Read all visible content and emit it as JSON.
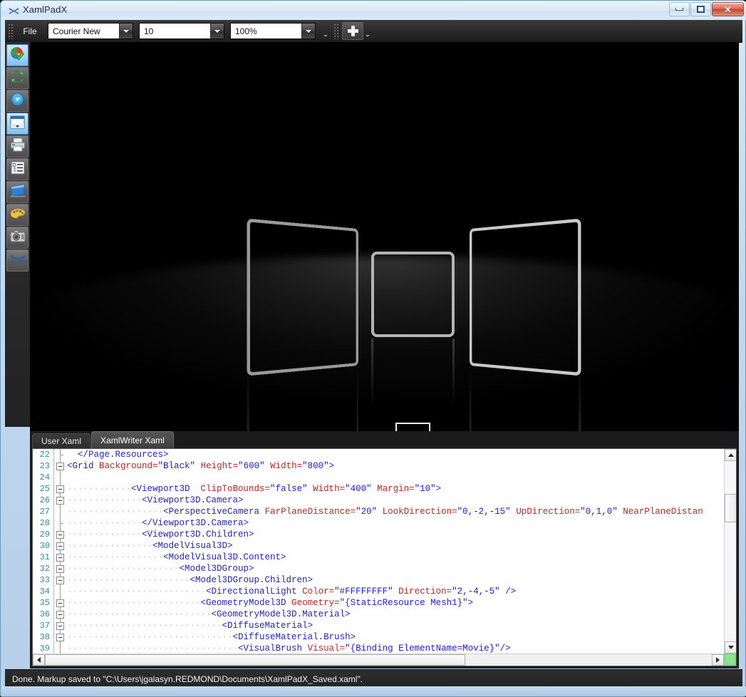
{
  "window": {
    "title": "XamlPadX",
    "app_icon": "xamlpadx-logo-icon",
    "caption": {
      "minimize": "minimize-icon",
      "maximize": "maximize-icon",
      "close": "✕"
    }
  },
  "toolbar": {
    "file_label_pre": "F",
    "file_label_accel": "F",
    "file_label_rest": "ile",
    "file_label": "File",
    "font_family": "Courier New",
    "font_size": "10",
    "zoom": "100%",
    "add_button": "+",
    "overflow": "chevron-down-icon"
  },
  "rail": {
    "items": [
      {
        "name": "refresh-render-icon",
        "selected": true
      },
      {
        "name": "auto-refresh-icon",
        "selected": false
      },
      {
        "name": "download-icon",
        "selected": false
      },
      {
        "name": "window-preview-icon",
        "selected": true
      },
      {
        "name": "print-icon",
        "selected": false
      },
      {
        "name": "tree-view-icon",
        "selected": false
      },
      {
        "name": "3d-panel-icon",
        "selected": false
      },
      {
        "name": "color-palette-icon",
        "selected": false
      },
      {
        "name": "camera-snapshot-icon",
        "selected": false
      },
      {
        "name": "xamlpadx-logo-icon",
        "selected": false
      }
    ]
  },
  "viewport": {
    "background": "#000000",
    "panels": [
      {
        "name": "left-panel",
        "stroke": "#9a9a9a"
      },
      {
        "name": "center-panel",
        "stroke": "#b4b4b4"
      },
      {
        "name": "right-panel",
        "stroke": "#c9c9c9"
      },
      {
        "name": "small-square",
        "stroke": "#f2f2f2"
      }
    ]
  },
  "editor": {
    "tabs": [
      {
        "label": "User Xaml",
        "active": false
      },
      {
        "label": "XamlWriter Xaml",
        "active": true
      }
    ],
    "first_line_number": 22,
    "lines": [
      {
        "n": 22,
        "fold": "tick",
        "tokens": [
          {
            "t": "pn",
            "s": "  "
          },
          {
            "t": "tg",
            "s": "</Page.Resources>"
          }
        ]
      },
      {
        "n": 23,
        "fold": "box",
        "tokens": [
          {
            "t": "tg",
            "s": "<Grid "
          },
          {
            "t": "at",
            "s": "Background="
          },
          {
            "t": "vl",
            "s": "\"Black\""
          },
          {
            "t": "pn",
            "s": " "
          },
          {
            "t": "at",
            "s": "Height="
          },
          {
            "t": "vl",
            "s": "\"600\""
          },
          {
            "t": "pn",
            "s": " "
          },
          {
            "t": "at",
            "s": "Width="
          },
          {
            "t": "vl",
            "s": "\"800\""
          },
          {
            "t": "tg",
            "s": ">"
          }
        ]
      },
      {
        "n": 24,
        "fold": "none",
        "tokens": []
      },
      {
        "n": 25,
        "fold": "box",
        "tokens": [
          {
            "t": "dot",
            "s": "············"
          },
          {
            "t": "tg",
            "s": "<Viewport3D "
          },
          {
            "t": "at",
            "s": " ClipToBounds="
          },
          {
            "t": "vl",
            "s": "\"false\""
          },
          {
            "t": "pn",
            "s": " "
          },
          {
            "t": "at",
            "s": "Width="
          },
          {
            "t": "vl",
            "s": "\"400\""
          },
          {
            "t": "pn",
            "s": " "
          },
          {
            "t": "at",
            "s": "Margin="
          },
          {
            "t": "vl",
            "s": "\"10\""
          },
          {
            "t": "tg",
            "s": ">"
          }
        ]
      },
      {
        "n": 26,
        "fold": "box",
        "tokens": [
          {
            "t": "dot",
            "s": "··············"
          },
          {
            "t": "tg",
            "s": "<Viewport3D.Camera>"
          }
        ]
      },
      {
        "n": 27,
        "fold": "none",
        "tokens": [
          {
            "t": "dot",
            "s": "··················"
          },
          {
            "t": "tg",
            "s": "<PerspectiveCamera "
          },
          {
            "t": "at",
            "s": "FarPlaneDistance="
          },
          {
            "t": "vl",
            "s": "\"20\""
          },
          {
            "t": "pn",
            "s": " "
          },
          {
            "t": "at",
            "s": "LookDirection="
          },
          {
            "t": "vl",
            "s": "\"0,-2,-15\""
          },
          {
            "t": "pn",
            "s": " "
          },
          {
            "t": "at",
            "s": "UpDirection="
          },
          {
            "t": "vl",
            "s": "\"0,1,0\""
          },
          {
            "t": "pn",
            "s": " "
          },
          {
            "t": "at",
            "s": "NearPlaneDistan"
          }
        ]
      },
      {
        "n": 28,
        "fold": "tick",
        "tokens": [
          {
            "t": "dot",
            "s": "··············"
          },
          {
            "t": "tg",
            "s": "</Viewport3D.Camera>"
          }
        ]
      },
      {
        "n": 29,
        "fold": "box",
        "tokens": [
          {
            "t": "dot",
            "s": "··············"
          },
          {
            "t": "tg",
            "s": "<Viewport3D.Children>"
          }
        ]
      },
      {
        "n": 30,
        "fold": "box",
        "tokens": [
          {
            "t": "dot",
            "s": "················"
          },
          {
            "t": "tg",
            "s": "<ModelVisual3D>"
          }
        ]
      },
      {
        "n": 31,
        "fold": "box",
        "tokens": [
          {
            "t": "dot",
            "s": "··················"
          },
          {
            "t": "tg",
            "s": "<ModelVisual3D.Content>"
          }
        ]
      },
      {
        "n": 32,
        "fold": "box",
        "tokens": [
          {
            "t": "dot",
            "s": "·····················"
          },
          {
            "t": "tg",
            "s": "<Model3DGroup>"
          }
        ]
      },
      {
        "n": 33,
        "fold": "box",
        "tokens": [
          {
            "t": "dot",
            "s": "·······················"
          },
          {
            "t": "tg",
            "s": "<Model3DGroup.Children>"
          }
        ]
      },
      {
        "n": 34,
        "fold": "none",
        "tokens": [
          {
            "t": "dot",
            "s": "··························"
          },
          {
            "t": "tg",
            "s": "<DirectionalLight "
          },
          {
            "t": "at",
            "s": "Color="
          },
          {
            "t": "vl",
            "s": "\"#FFFFFFFF\""
          },
          {
            "t": "pn",
            "s": " "
          },
          {
            "t": "at",
            "s": "Direction="
          },
          {
            "t": "vl",
            "s": "\"2,-4,-5\""
          },
          {
            "t": "tg",
            "s": " />"
          }
        ]
      },
      {
        "n": 35,
        "fold": "box",
        "tokens": [
          {
            "t": "dot",
            "s": "·························"
          },
          {
            "t": "tg",
            "s": "<GeometryModel3D "
          },
          {
            "t": "at",
            "s": "Geometry="
          },
          {
            "t": "vl",
            "s": "\"{StaticResource Mesh1}\""
          },
          {
            "t": "tg",
            "s": ">"
          }
        ]
      },
      {
        "n": 36,
        "fold": "box",
        "tokens": [
          {
            "t": "dot",
            "s": "···························"
          },
          {
            "t": "tg",
            "s": "<GeometryModel3D.Material>"
          }
        ]
      },
      {
        "n": 37,
        "fold": "box",
        "tokens": [
          {
            "t": "dot",
            "s": "·····························"
          },
          {
            "t": "tg",
            "s": "<DiffuseMaterial>"
          }
        ]
      },
      {
        "n": 38,
        "fold": "box",
        "tokens": [
          {
            "t": "dot",
            "s": "·······························"
          },
          {
            "t": "tg",
            "s": "<DiffuseMaterial.Brush>"
          }
        ]
      },
      {
        "n": 39,
        "fold": "none",
        "tokens": [
          {
            "t": "dot",
            "s": "································"
          },
          {
            "t": "tg",
            "s": "<VisualBrush "
          },
          {
            "t": "at",
            "s": "Visual="
          },
          {
            "t": "vl",
            "s": "\"{Binding ElementName=Movie}\""
          },
          {
            "t": "tg",
            "s": "/>"
          }
        ]
      }
    ],
    "scroll": {
      "vertical_thumb_top_pct": 18,
      "horizontal_thumb_width_pct": 63
    }
  },
  "statusbar": {
    "message": "Done. Markup saved to \"C:\\Users\\jgalasyn.REDMOND\\Documents\\XamlPadX_Saved.xaml\"."
  }
}
